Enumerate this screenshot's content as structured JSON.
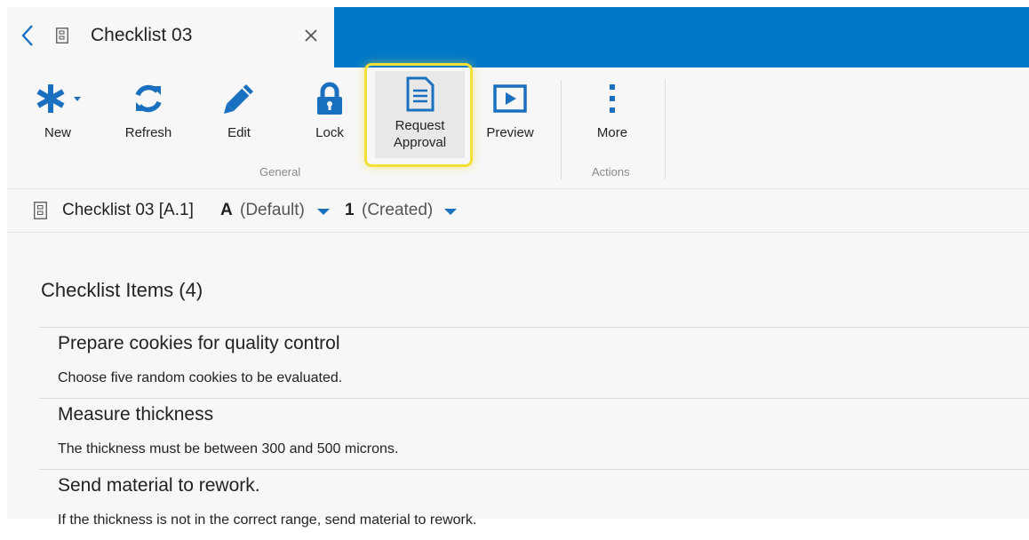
{
  "tab": {
    "title": "Checklist 03"
  },
  "ribbon": {
    "buttons": [
      {
        "label": "New",
        "icon": "asterisk-icon"
      },
      {
        "label": "Refresh",
        "icon": "refresh-icon"
      },
      {
        "label": "Edit",
        "icon": "pencil-icon"
      },
      {
        "label": "Lock",
        "icon": "lock-icon"
      },
      {
        "label": "Request Approval",
        "icon": "document-list-icon",
        "highlighted": true
      },
      {
        "label": "Preview",
        "icon": "play-frame-icon"
      },
      {
        "label": "More",
        "icon": "more-vertical-icon"
      }
    ],
    "groups": {
      "general": "General",
      "actions": "Actions"
    }
  },
  "breadcrumb": {
    "title": "Checklist 03 [A.1]",
    "revision_code": "A",
    "revision_label": "(Default)",
    "version_code": "1",
    "version_label": "(Created)"
  },
  "checklist": {
    "heading": "Checklist Items (4)",
    "items": [
      {
        "name": "Prepare cookies for quality control",
        "description": "Choose five random cookies to be evaluated."
      },
      {
        "name": "Measure thickness",
        "description": "The thickness must be between 300 and 500 microns."
      },
      {
        "name": "Send material to rework.",
        "description": "If the thickness is not in the correct range, send material to rework."
      }
    ]
  },
  "colors": {
    "brand_blue": "#0078c8",
    "icon_blue": "#1a70c0",
    "highlight": "#f2df38"
  }
}
